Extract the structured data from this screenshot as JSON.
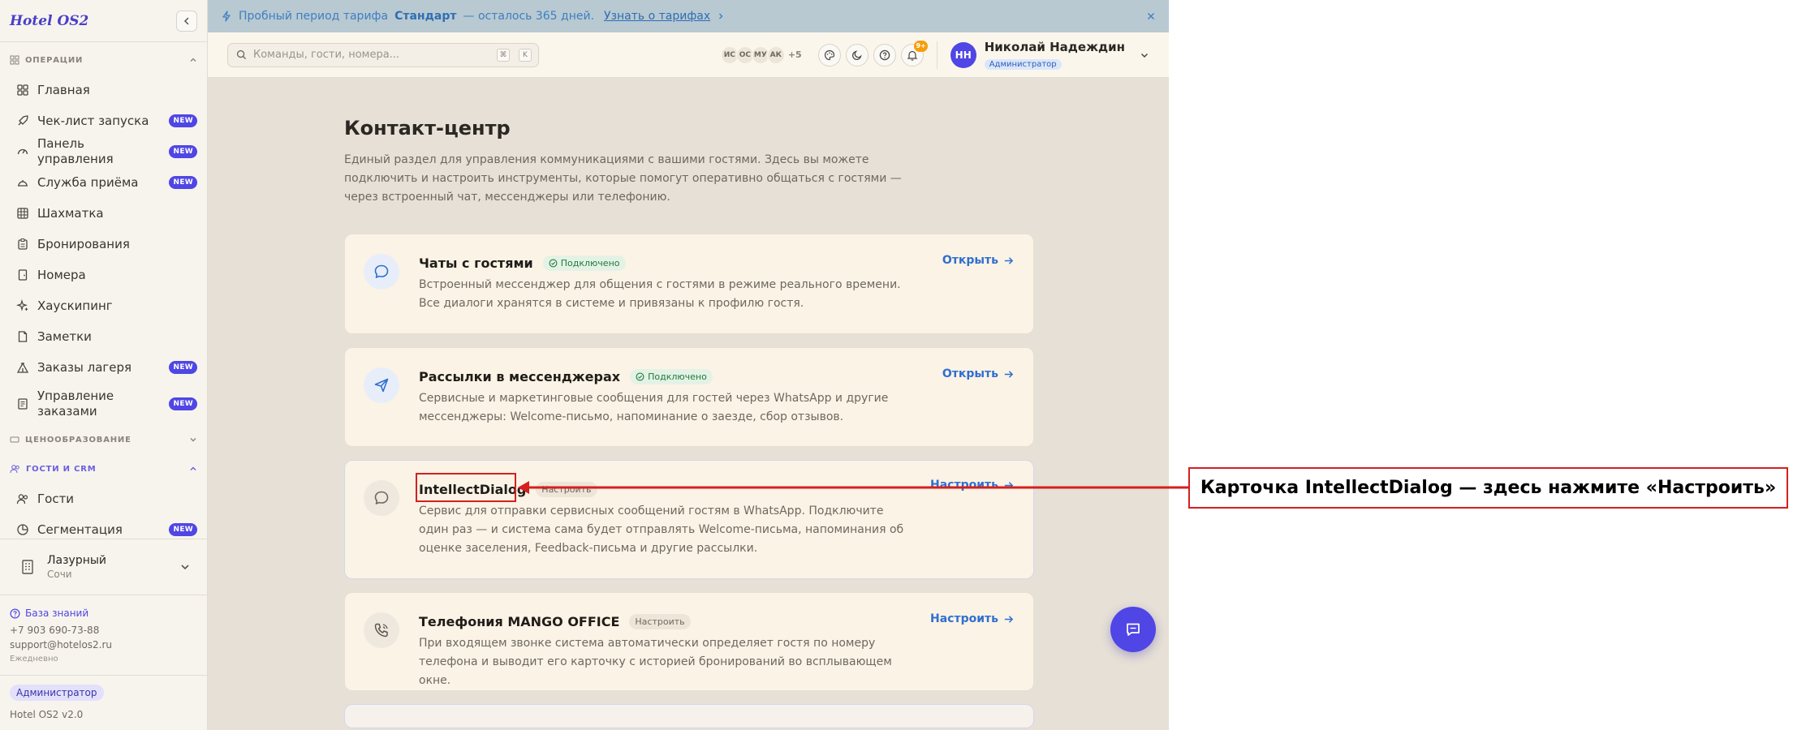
{
  "sidebar": {
    "logo": "Hotel OS2",
    "sections": {
      "ops": {
        "label": "ОПЕРАЦИИ"
      },
      "pricing": {
        "label": "ЦЕНООБРАЗОВАНИЕ"
      },
      "crm": {
        "label": "ГОСТИ И CRM"
      }
    },
    "new_badge": "NEW",
    "items": [
      {
        "label": "Главная",
        "icon": "dashboard-grid-icon",
        "new": false
      },
      {
        "label": "Чек-лист запуска",
        "icon": "rocket-icon",
        "new": true
      },
      {
        "label": "Панель управления",
        "icon": "gauge-icon",
        "new": true
      },
      {
        "label": "Служба приёма",
        "icon": "concierge-bell-icon",
        "new": true
      },
      {
        "label": "Шахматка",
        "icon": "grid-table-icon",
        "new": false
      },
      {
        "label": "Бронирования",
        "icon": "clipboard-icon",
        "new": false
      },
      {
        "label": "Номера",
        "icon": "door-icon",
        "new": false
      },
      {
        "label": "Хаускипинг",
        "icon": "sparkles-icon",
        "new": false
      },
      {
        "label": "Заметки",
        "icon": "note-icon",
        "new": false
      },
      {
        "label": "Заказы лагеря",
        "icon": "tent-icon",
        "new": true
      },
      {
        "label": "Управление заказами",
        "icon": "receipt-icon",
        "new": true
      },
      {
        "label": "Гости",
        "icon": "users-icon",
        "new": false
      },
      {
        "label": "Сегментация",
        "icon": "pie-chart-icon",
        "new": true
      }
    ],
    "hotel": {
      "name": "Лазурный",
      "city": "Сочи"
    },
    "footer": {
      "knowledge_base": "База знаний",
      "phone": "+7 903 690-73-88",
      "email": "support@hotelos2.ru",
      "hours": "Ежедневно",
      "role": "Администратор",
      "version": "Hotel OS2 v2.0"
    }
  },
  "banner": {
    "text_before": "Пробный период тарифа",
    "plan": "Стандарт",
    "text_after": "— осталось 365 дней.",
    "link": "Узнать о тарифах"
  },
  "topbar": {
    "search_placeholder": "Команды, гости, номера...",
    "shortcut_mod": "⌘",
    "shortcut_key": "K",
    "presence": [
      "ИС",
      "ОС",
      "МУ",
      "АК"
    ],
    "presence_more": "+5",
    "notifications_count": "9+",
    "user": {
      "initials": "НН",
      "name": "Николай Надеждин",
      "role": "Администратор"
    }
  },
  "page": {
    "title": "Контакт-центр",
    "description": "Единый раздел для управления коммуникациями с вашими гостями. Здесь вы можете подключить и настроить инструменты, которые помогут оперативно общаться с гостями — через встроенный чат, мессенджеры или телефонию."
  },
  "cards": [
    {
      "title": "Чаты с гостями",
      "status": "Подключено",
      "description": "Встроенный мессенджер для общения с гостями в режиме реального времени. Все диалоги хранятся в системе и привязаны к профилю гостя.",
      "action": "Открыть",
      "icon": "chat-bubble-icon"
    },
    {
      "title": "Рассылки в мессенджерах",
      "status": "Подключено",
      "description": "Сервисные и маркетинговые сообщения для гостей через WhatsApp и другие мессенджеры: Welcome-письмо, напоминание о заезде, сбор отзывов.",
      "action": "Открыть",
      "icon": "send-icon"
    },
    {
      "title": "IntellectDialog",
      "status": "Настроить",
      "description": "Сервис для отправки сервисных сообщений гостям в WhatsApp. Подключите один раз — и система сама будет отправлять Welcome-письма, напоминания об оценке заселения, Feedback-письма и другие рассылки.",
      "action": "Настроить",
      "icon": "chat-bubble-icon"
    },
    {
      "title": "Телефония MANGO OFFICE",
      "status": "Настроить",
      "description": "При входящем звонке система автоматически определяет гостя по номеру телефона и выводит его карточку с историей бронирований во всплывающем окне.",
      "action": "Настроить",
      "icon": "phone-icon"
    }
  ],
  "annotation": {
    "callout": "Карточка IntellectDialog — здесь нажмите «Настроить»"
  },
  "colors": {
    "accent": "#4f46e5",
    "link": "#2f6fd0",
    "annotation": "#d32020"
  }
}
